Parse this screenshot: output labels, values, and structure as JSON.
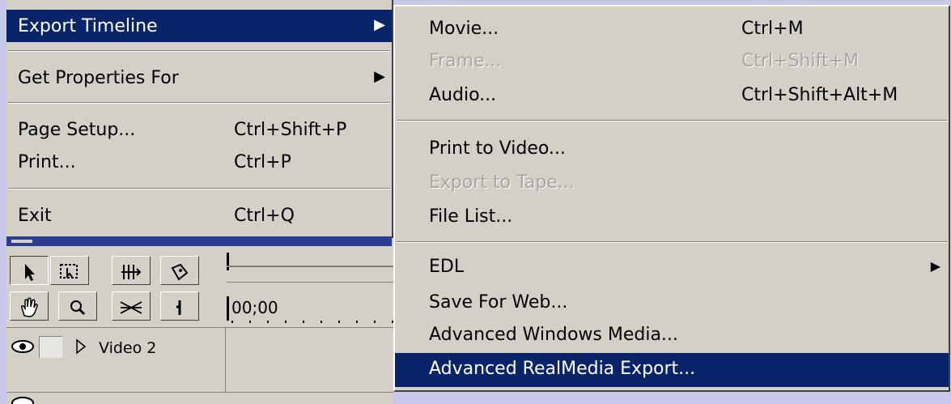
{
  "file_menu": {
    "items": [
      {
        "label": "Export Timeline",
        "shortcut": "",
        "submenu_arrow": "▶"
      },
      {
        "label": "Get Properties For",
        "shortcut": "",
        "submenu_arrow": "▶"
      },
      {
        "label": "Page Setup...",
        "shortcut": "Ctrl+Shift+P"
      },
      {
        "label": "Print...",
        "shortcut": "Ctrl+P"
      },
      {
        "label": "Exit",
        "shortcut": "Ctrl+Q"
      }
    ]
  },
  "export_submenu": {
    "items": [
      {
        "label": "Movie...",
        "shortcut": "Ctrl+M"
      },
      {
        "label": "Frame...",
        "shortcut": "Ctrl+Shift+M"
      },
      {
        "label": "Audio...",
        "shortcut": "Ctrl+Shift+Alt+M"
      },
      {
        "label": "Print to Video...",
        "shortcut": ""
      },
      {
        "label": "Export to Tape...",
        "shortcut": ""
      },
      {
        "label": "File List...",
        "shortcut": ""
      },
      {
        "label": "EDL",
        "shortcut": "",
        "submenu_arrow": "▶"
      },
      {
        "label": "Save For Web...",
        "shortcut": ""
      },
      {
        "label": "Advanced Windows Media...",
        "shortcut": ""
      },
      {
        "label": "Advanced RealMedia Export...",
        "shortcut": ""
      }
    ]
  },
  "timeline": {
    "timecode": "00;00",
    "track_video2": "Video 2"
  },
  "colors": {
    "selection": "#0a246a",
    "menu_bg": "#d4d0c8",
    "desktop": "#c8c8ea"
  },
  "icons": {
    "selection_tool": "arrow-icon",
    "range_select_tool": "range-select-icon",
    "track_tool": "track-select-icon",
    "razor_tool": "razor-icon",
    "hand_tool": "hand-icon",
    "zoom_tool": "zoom-icon",
    "cross_fade_tool": "cross-fade-icon",
    "in_point_tool": "edit-point-icon",
    "eye": "eye-icon",
    "expand": "expand-triangle-icon"
  }
}
